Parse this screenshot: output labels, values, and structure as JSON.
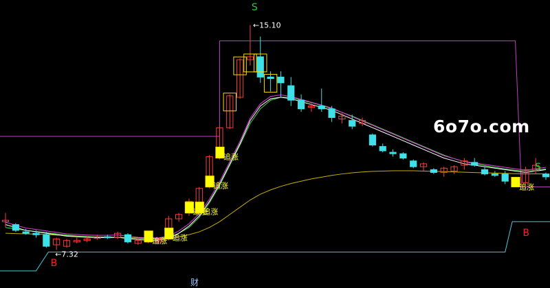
{
  "chart_data": {
    "type": "candlestick",
    "colors": {
      "background": "#000000",
      "up": "#ff3b3b",
      "down": "#3fe0e8",
      "signal_box": "#ffe000",
      "signal_fill": "#ffff00",
      "ma_short": "#ffffff",
      "ma_mid": "#49d447",
      "ma_long": "#c8b000",
      "ma_extra": "#e040e0",
      "band_upper": "#c040c0",
      "band_lower": "#40d0e0",
      "buy_marker": "#ff2020",
      "sell_marker": "#20d040",
      "label_signal": "#ffff40",
      "label_price": "#ffffff"
    },
    "max_price_label": "15.10",
    "min_price_label": "7.32",
    "markers": [
      {
        "type": "B",
        "label": "B"
      },
      {
        "type": "S",
        "label": "S"
      },
      {
        "type": "B",
        "label": "B"
      },
      {
        "type": "S",
        "label": "S"
      }
    ],
    "signal_label": "追涨",
    "candles": [
      {
        "o": 8.3,
        "h": 8.6,
        "l": 8.1,
        "c": 8.35
      },
      {
        "o": 8.2,
        "h": 8.25,
        "l": 7.95,
        "c": 8.0
      },
      {
        "o": 7.95,
        "h": 8.05,
        "l": 7.85,
        "c": 7.9
      },
      {
        "o": 7.9,
        "h": 8.0,
        "l": 7.75,
        "c": 7.85
      },
      {
        "o": 7.85,
        "h": 7.95,
        "l": 7.4,
        "c": 7.45
      },
      {
        "o": 7.5,
        "h": 7.75,
        "l": 7.32,
        "c": 7.7
      },
      {
        "o": 7.45,
        "h": 7.7,
        "l": 7.4,
        "c": 7.65
      },
      {
        "o": 7.6,
        "h": 7.75,
        "l": 7.55,
        "c": 7.65
      },
      {
        "o": 7.65,
        "h": 7.8,
        "l": 7.6,
        "c": 7.7
      },
      {
        "o": 7.72,
        "h": 7.85,
        "l": 7.68,
        "c": 7.78
      },
      {
        "o": 7.78,
        "h": 7.85,
        "l": 7.7,
        "c": 7.76
      },
      {
        "o": 7.76,
        "h": 7.95,
        "l": 7.7,
        "c": 7.9
      },
      {
        "o": 7.85,
        "h": 7.9,
        "l": 7.55,
        "c": 7.6
      },
      {
        "o": 7.55,
        "h": 7.7,
        "l": 7.5,
        "c": 7.65
      },
      {
        "o": 7.6,
        "h": 7.75,
        "l": 7.55,
        "c": 7.68
      },
      {
        "o": 7.6,
        "h": 7.75,
        "l": 7.55,
        "c": 7.7
      },
      {
        "o": 7.7,
        "h": 8.5,
        "l": 7.65,
        "c": 8.4
      },
      {
        "o": 8.4,
        "h": 8.6,
        "l": 8.3,
        "c": 8.55
      },
      {
        "o": 8.6,
        "h": 9.1,
        "l": 8.5,
        "c": 9.0
      },
      {
        "o": 8.6,
        "h": 9.5,
        "l": 8.55,
        "c": 9.45
      },
      {
        "o": 9.5,
        "h": 10.6,
        "l": 9.45,
        "c": 10.55
      },
      {
        "o": 10.5,
        "h": 11.6,
        "l": 10.45,
        "c": 11.55
      },
      {
        "o": 11.55,
        "h": 12.7,
        "l": 11.5,
        "c": 12.65
      },
      {
        "o": 12.6,
        "h": 13.95,
        "l": 12.55,
        "c": 13.9
      },
      {
        "o": 13.9,
        "h": 15.1,
        "l": 13.7,
        "c": 14.0
      },
      {
        "o": 14.0,
        "h": 14.7,
        "l": 13.1,
        "c": 13.3
      },
      {
        "o": 13.3,
        "h": 13.5,
        "l": 12.8,
        "c": 13.25
      },
      {
        "o": 13.3,
        "h": 13.5,
        "l": 12.6,
        "c": 13.1
      },
      {
        "o": 13.0,
        "h": 13.3,
        "l": 12.3,
        "c": 12.5
      },
      {
        "o": 12.5,
        "h": 12.7,
        "l": 12.1,
        "c": 12.2
      },
      {
        "o": 12.25,
        "h": 12.4,
        "l": 12.1,
        "c": 12.3
      },
      {
        "o": 12.3,
        "h": 12.9,
        "l": 12.1,
        "c": 12.2
      },
      {
        "o": 12.2,
        "h": 12.3,
        "l": 11.75,
        "c": 11.9
      },
      {
        "o": 11.85,
        "h": 12.05,
        "l": 11.7,
        "c": 11.95
      },
      {
        "o": 11.8,
        "h": 12.0,
        "l": 11.5,
        "c": 11.6
      },
      {
        "o": 11.7,
        "h": 11.9,
        "l": 11.6,
        "c": 11.8
      },
      {
        "o": 11.3,
        "h": 11.35,
        "l": 10.9,
        "c": 10.95
      },
      {
        "o": 10.9,
        "h": 11.0,
        "l": 10.7,
        "c": 10.75
      },
      {
        "o": 10.7,
        "h": 10.8,
        "l": 10.55,
        "c": 10.65
      },
      {
        "o": 10.65,
        "h": 10.7,
        "l": 10.45,
        "c": 10.5
      },
      {
        "o": 10.4,
        "h": 10.45,
        "l": 10.15,
        "c": 10.2
      },
      {
        "o": 10.2,
        "h": 10.35,
        "l": 10.05,
        "c": 10.3
      },
      {
        "o": 10.1,
        "h": 10.15,
        "l": 9.95,
        "c": 10.0
      },
      {
        "o": 10.0,
        "h": 10.2,
        "l": 9.85,
        "c": 10.15
      },
      {
        "o": 10.05,
        "h": 10.25,
        "l": 9.95,
        "c": 10.2
      },
      {
        "o": 10.25,
        "h": 10.5,
        "l": 10.1,
        "c": 10.4
      },
      {
        "o": 10.35,
        "h": 10.5,
        "l": 10.2,
        "c": 10.25
      },
      {
        "o": 10.1,
        "h": 10.2,
        "l": 9.9,
        "c": 9.95
      },
      {
        "o": 9.95,
        "h": 10.05,
        "l": 9.85,
        "c": 9.9
      },
      {
        "o": 9.95,
        "h": 10.05,
        "l": 9.6,
        "c": 9.7
      },
      {
        "o": 9.7,
        "h": 9.8,
        "l": 9.55,
        "c": 9.6
      },
      {
        "o": 9.65,
        "h": 10.2,
        "l": 9.6,
        "c": 10.1
      },
      {
        "o": 10.05,
        "h": 10.5,
        "l": 9.95,
        "c": 10.25
      },
      {
        "o": 9.95,
        "h": 10.0,
        "l": 9.75,
        "c": 9.85
      }
    ],
    "ma_short": [
      8.2,
      8.1,
      8.0,
      7.95,
      7.9,
      7.85,
      7.8,
      7.78,
      7.76,
      7.75,
      7.75,
      7.76,
      7.72,
      7.68,
      7.66,
      7.66,
      7.72,
      7.9,
      8.15,
      8.5,
      9.0,
      9.6,
      10.3,
      11.0,
      11.8,
      12.3,
      12.55,
      12.6,
      12.55,
      12.45,
      12.35,
      12.25,
      12.15,
      12.0,
      11.85,
      11.7,
      11.55,
      11.4,
      11.25,
      11.1,
      10.95,
      10.8,
      10.65,
      10.5,
      10.4,
      10.3,
      10.25,
      10.2,
      10.15,
      10.1,
      10.05,
      10.0,
      10.05,
      10.1
    ],
    "ma_mid": [
      8.1,
      8.05,
      8.0,
      7.96,
      7.92,
      7.88,
      7.84,
      7.81,
      7.79,
      7.78,
      7.77,
      7.76,
      7.74,
      7.72,
      7.7,
      7.7,
      7.75,
      7.9,
      8.1,
      8.45,
      8.95,
      9.55,
      10.25,
      10.95,
      11.7,
      12.2,
      12.5,
      12.6,
      12.6,
      12.5,
      12.42,
      12.32,
      12.2,
      12.08,
      11.95,
      11.8,
      11.65,
      11.5,
      11.35,
      11.2,
      11.05,
      10.9,
      10.75,
      10.6,
      10.48,
      10.38,
      10.3,
      10.24,
      10.18,
      10.12,
      10.08,
      10.05,
      10.08,
      10.12
    ],
    "ma_long": [
      7.9,
      7.89,
      7.88,
      7.87,
      7.86,
      7.84,
      7.82,
      7.8,
      7.79,
      7.78,
      7.77,
      7.76,
      7.75,
      7.74,
      7.73,
      7.73,
      7.74,
      7.78,
      7.85,
      7.95,
      8.1,
      8.3,
      8.55,
      8.8,
      9.05,
      9.25,
      9.4,
      9.52,
      9.62,
      9.7,
      9.78,
      9.84,
      9.9,
      9.95,
      9.99,
      10.02,
      10.04,
      10.05,
      10.06,
      10.06,
      10.06,
      10.05,
      10.04,
      10.03,
      10.02,
      10.01,
      10.0,
      9.99,
      9.98,
      9.97,
      9.96,
      9.95,
      9.95,
      9.95
    ],
    "band_upper_y": 11.25,
    "band_upper_peak": 14.55,
    "band_lower_y": 7.25
  }
}
